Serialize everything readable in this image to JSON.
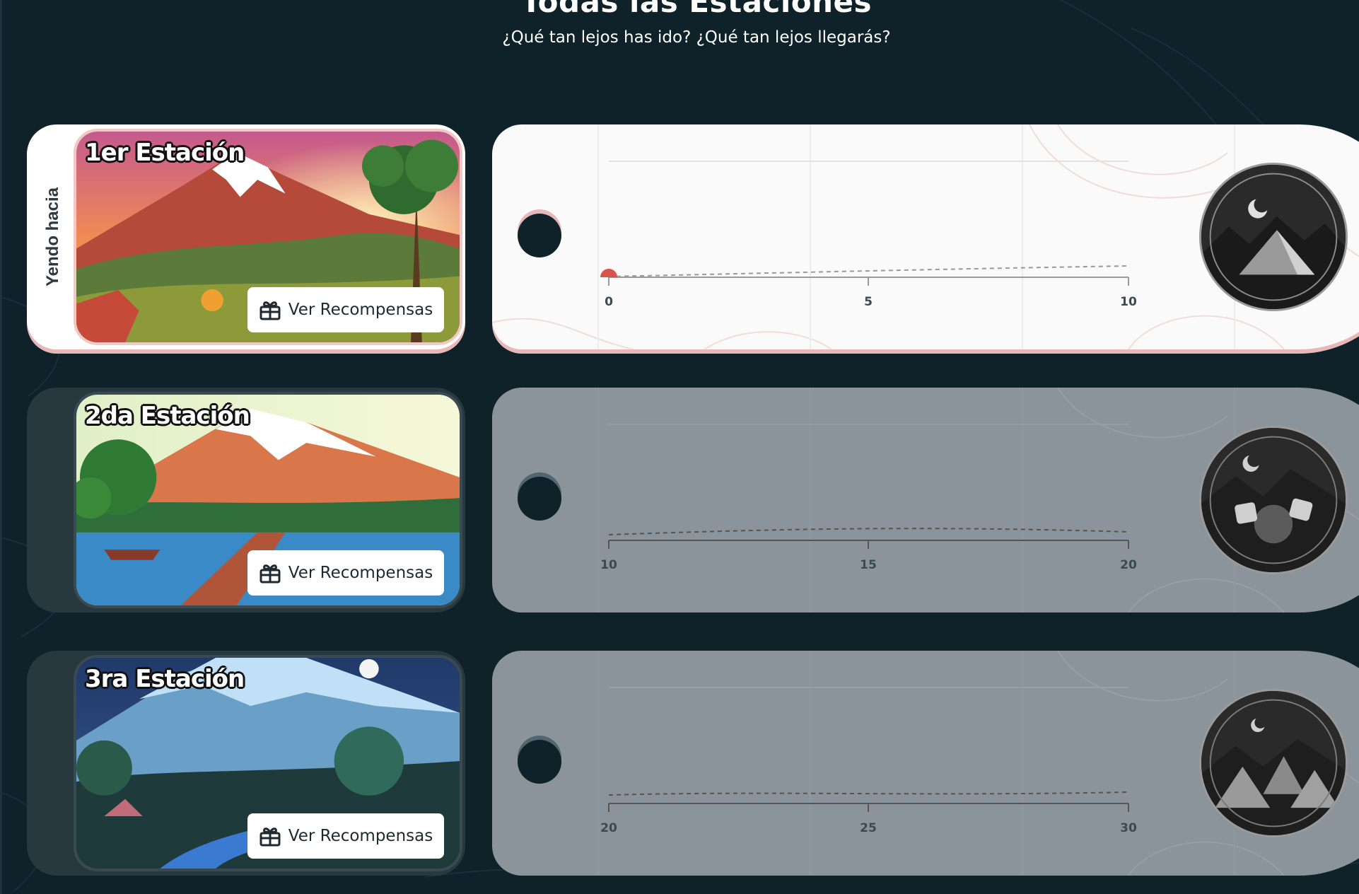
{
  "header": {
    "title": "Todas las Estaciones",
    "subtitle": "¿Qué tan lejos has ido? ¿Qué tan lejos llegarás?"
  },
  "going_label": "Yendo hacia",
  "stations": [
    {
      "name": "1er Estación",
      "rewards_label": "Ver Recompensas",
      "ticks": [
        "0",
        "5",
        "10"
      ],
      "progress": 0,
      "active": true,
      "badge_icon": "tent-night-icon"
    },
    {
      "name": "2da Estación",
      "rewards_label": "Ver Recompensas",
      "ticks": [
        "10",
        "15",
        "20"
      ],
      "progress": 0,
      "active": false,
      "badge_icon": "campfire-icon"
    },
    {
      "name": "3ra Estación",
      "rewards_label": "Ver Recompensas",
      "ticks": [
        "20",
        "25",
        "30"
      ],
      "progress": 0,
      "active": false,
      "badge_icon": "campsite-tents-icon"
    }
  ],
  "colors": {
    "background": "#0f2129",
    "active_card": "#fbfafa",
    "locked_card": "#8a949a",
    "accent": "#d9534f",
    "card_edge": "#e8b7b7"
  }
}
